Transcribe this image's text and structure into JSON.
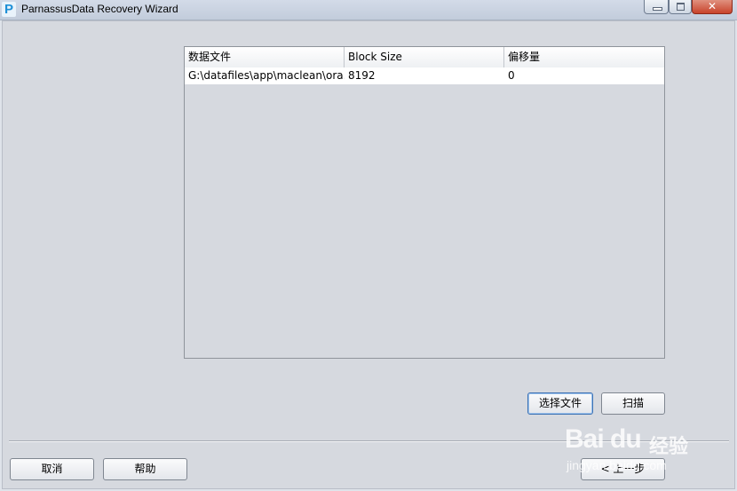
{
  "window": {
    "title": "ParnassusData Recovery Wizard",
    "logo_letter": "P",
    "close_symbol": "✕"
  },
  "table": {
    "headers": [
      "数据文件",
      "Block Size",
      "偏移量"
    ],
    "rows": [
      [
        "G:\\datafiles\\app\\maclean\\ora...",
        "8192",
        "0"
      ]
    ]
  },
  "buttons": {
    "choose_file": "选择文件",
    "scan": "扫描",
    "cancel": "取消",
    "help": "帮助",
    "prev": "< 上一步"
  },
  "watermark": {
    "brand": "Bai du",
    "cn": "经验",
    "url": "jingyan.baidu.com"
  }
}
